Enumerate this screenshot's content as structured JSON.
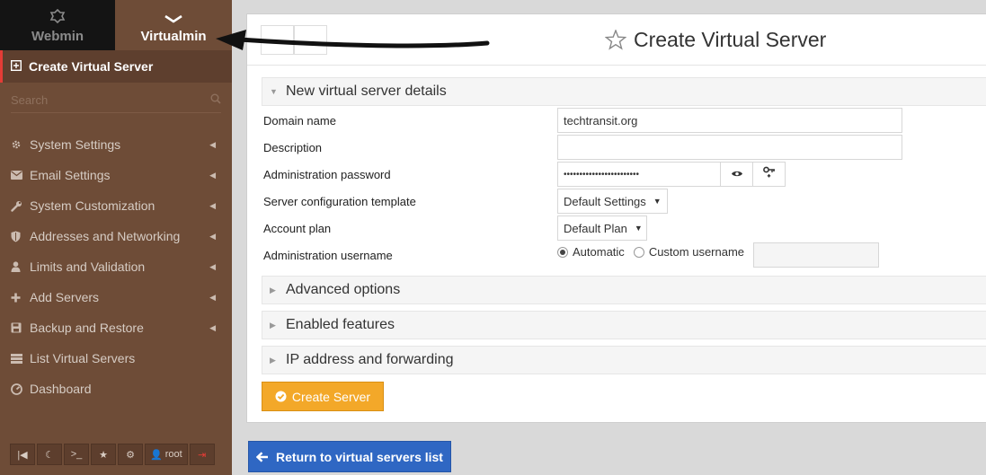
{
  "switch": {
    "webmin": "Webmin",
    "virtualmin": "Virtualmin"
  },
  "sidebar": {
    "active_item": "Create Virtual Server",
    "search_placeholder": "Search",
    "items": [
      {
        "label": "System Settings",
        "icon": "gear-icon"
      },
      {
        "label": "Email Settings",
        "icon": "envelope-icon"
      },
      {
        "label": "System Customization",
        "icon": "wrench-icon"
      },
      {
        "label": "Addresses and Networking",
        "icon": "shield-icon"
      },
      {
        "label": "Limits and Validation",
        "icon": "user-icon"
      },
      {
        "label": "Add Servers",
        "icon": "plus-icon"
      },
      {
        "label": "Backup and Restore",
        "icon": "floppy-icon"
      },
      {
        "label": "List Virtual Servers",
        "icon": "list-icon"
      },
      {
        "label": "Dashboard",
        "icon": "dashboard-icon"
      }
    ],
    "bottom": {
      "user": "root"
    }
  },
  "page": {
    "title": "Create Virtual Server"
  },
  "sections": {
    "details": "New virtual server details",
    "advanced": "Advanced options",
    "features": "Enabled features",
    "ip": "IP address and forwarding"
  },
  "form": {
    "domain_label": "Domain name",
    "domain_value": "techtransit.org",
    "description_label": "Description",
    "description_value": "",
    "password_label": "Administration password",
    "password_value": "••••••••••••••••••••••••",
    "template_label": "Server configuration template",
    "template_value": "Default Settings",
    "plan_label": "Account plan",
    "plan_value": "Default Plan",
    "username_label": "Administration username",
    "username_auto": "Automatic",
    "username_custom": "Custom username"
  },
  "buttons": {
    "create": "Create Server",
    "return": "Return to virtual servers list"
  },
  "colors": {
    "sidebar_bg": "#6e4c37",
    "accent_orange": "#f3a829",
    "accent_blue": "#2f67c3",
    "active_marker": "#e43c36"
  }
}
